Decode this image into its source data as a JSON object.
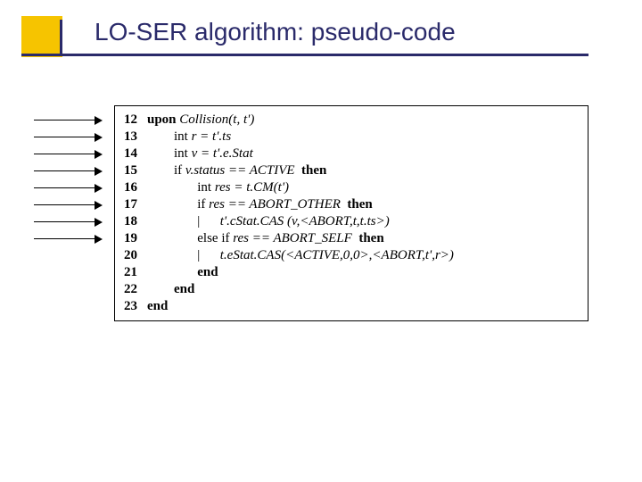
{
  "title": "LO-SER algorithm: pseudo-code",
  "code": {
    "l12": {
      "n": "12",
      "kw": "upon",
      "rest": " Collision(t, t')"
    },
    "l13": {
      "n": "13",
      "pre": "        int ",
      "rest": "r = t'.ts"
    },
    "l14": {
      "n": "14",
      "pre": "        int ",
      "rest": "v = t'.e.Stat"
    },
    "l15": {
      "n": "15",
      "pre": "        if ",
      "cond": "v.status == ACTIVE",
      "then": "  then"
    },
    "l16": {
      "n": "16",
      "pre": "               int ",
      "rest": "res = t.CM(t')"
    },
    "l17": {
      "n": "17",
      "pre": "               if ",
      "cond": "res == ABORT_OTHER",
      "then": "  then"
    },
    "l18": {
      "n": "18",
      "pre": "               |      ",
      "rest": "t'.cStat.CAS (v,<ABORT,t,t.ts>)"
    },
    "l19": {
      "n": "19",
      "pre": "               else if ",
      "cond": "res == ABORT_SELF",
      "then": "  then"
    },
    "l20": {
      "n": "20",
      "pre": "               |      ",
      "rest": "t.eStat.CAS(<ACTIVE,0,0>,<ABORT,t',r>)"
    },
    "l21": {
      "n": "21",
      "pre": "               ",
      "kw": "end"
    },
    "l22": {
      "n": "22",
      "pre": "        ",
      "kw": "end"
    },
    "l23": {
      "n": "23",
      "kw": "end"
    }
  }
}
